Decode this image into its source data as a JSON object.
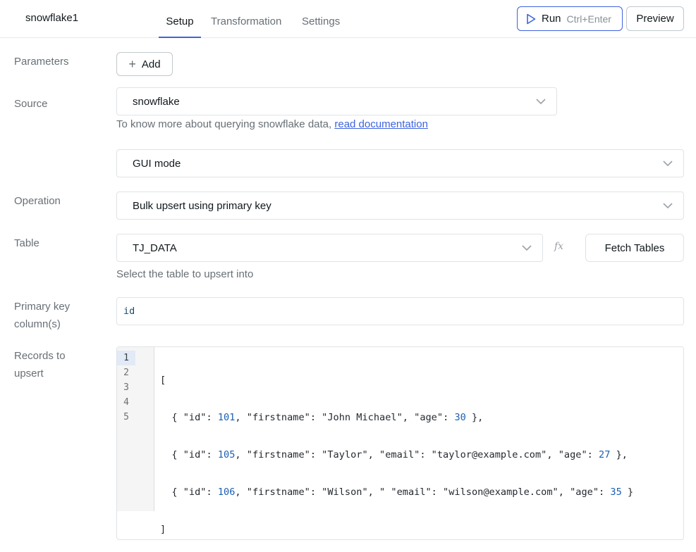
{
  "header": {
    "query_name": "snowflake1",
    "tabs": [
      {
        "label": "Setup",
        "active": true
      },
      {
        "label": "Transformation",
        "active": false
      },
      {
        "label": "Settings",
        "active": false
      }
    ],
    "run_label": "Run",
    "run_shortcut": "Ctrl+Enter",
    "preview_label": "Preview"
  },
  "form": {
    "parameters": {
      "label": "Parameters",
      "add_label": "Add"
    },
    "source": {
      "label": "Source",
      "value": "snowflake",
      "helper_prefix": "To know more about querying snowflake data, ",
      "helper_link": "read documentation"
    },
    "mode": {
      "value": "GUI mode"
    },
    "operation": {
      "label": "Operation",
      "value": "Bulk upsert using primary key"
    },
    "table": {
      "label": "Table",
      "value": "TJ_DATA",
      "fx_label": "fx",
      "fetch_label": "Fetch Tables",
      "helper": "Select the table to upsert into"
    },
    "primary_key": {
      "label_line1": "Primary key",
      "label_line2": "column(s)",
      "value": "id"
    },
    "records": {
      "label_line1": "Records to",
      "label_line2": "upsert",
      "line_numbers": [
        "1",
        "2",
        "3",
        "4",
        "5"
      ],
      "code_lines": [
        "[",
        "  { \"id\": 101, \"firstname\": \"John Michael\", \"age\": 30 },",
        "  { \"id\": 105, \"firstname\": \"Taylor\", \"email\": \"taylor@example.com\", \"age\": 27 },",
        "  { \"id\": 106, \"firstname\": \"Wilson\", \" \"email\": \"wilson@example.com\", \"age\": 35 }",
        "]"
      ]
    }
  },
  "colors": {
    "accent": "#3e63dd",
    "muted_text": "#687076",
    "border": "#dfe3e6"
  }
}
